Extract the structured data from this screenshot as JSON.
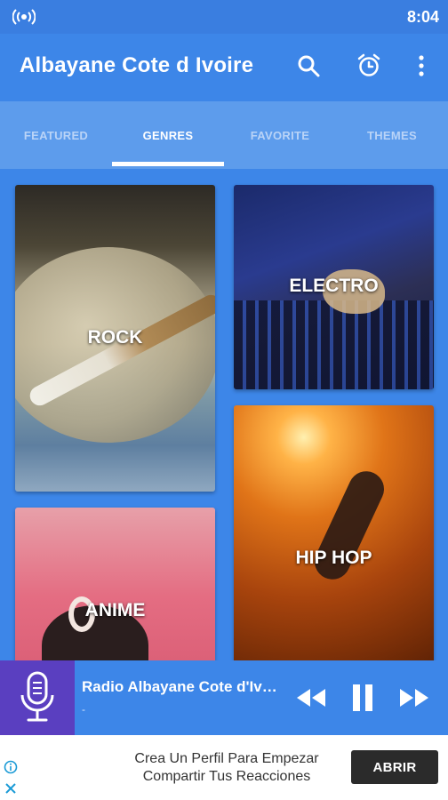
{
  "status_bar": {
    "time": "8:04",
    "icon": "radio-broadcast-icon"
  },
  "app_bar": {
    "title": "Albayane Cote d Ivoire",
    "icons": [
      "search-icon",
      "alarm-icon",
      "more-vertical-icon"
    ]
  },
  "tabs": [
    {
      "label": "FEATURED",
      "active": false
    },
    {
      "label": "GENRES",
      "active": true
    },
    {
      "label": "FAVORITE",
      "active": false
    },
    {
      "label": "THEMES",
      "active": false
    }
  ],
  "genres": [
    {
      "label": "ROCK"
    },
    {
      "label": "ELECTRO"
    },
    {
      "label": "HIP HOP"
    },
    {
      "label": "ANIME"
    }
  ],
  "player": {
    "station": "Radio Albayane Cote d'Ivoire",
    "subtitle": "-",
    "icons": [
      "microphone-icon",
      "rewind-icon",
      "pause-icon",
      "fast-forward-icon"
    ]
  },
  "ad": {
    "text_line1": "Crea Un Perfil Para Empezar",
    "text_line2": "Compartir Tus Reacciones",
    "cta": "ABRIR",
    "icons": [
      "ad-info-icon",
      "ad-close-icon"
    ]
  },
  "colors": {
    "primary": "#3d86e8",
    "tab_bar": "#5d9cec",
    "mic_box": "#5a3fc0",
    "ad_button": "#2b2b2b"
  }
}
